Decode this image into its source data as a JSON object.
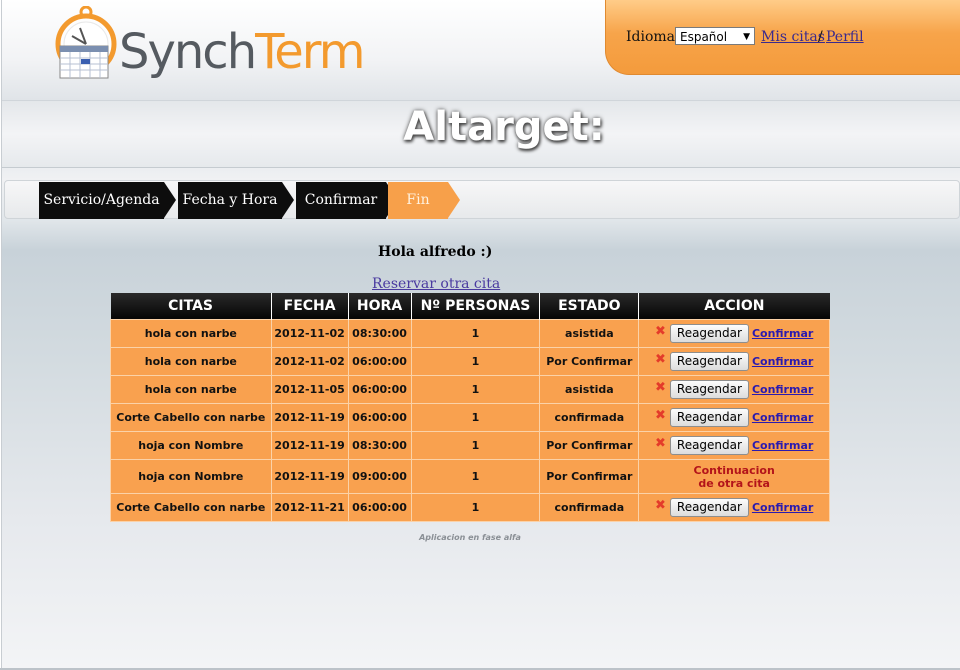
{
  "header": {
    "logo_text_1": "Synch",
    "logo_text_2": "Term",
    "language_label": "Idioma:",
    "language_selected": "Español",
    "mis_citas": "Mis citas",
    "separator": "/",
    "perfil": "Perfil"
  },
  "banner": {
    "title": "Altarget:"
  },
  "steps": [
    {
      "label": "Servicio/Agenda",
      "state": "done"
    },
    {
      "label": "Fecha y Hora",
      "state": "done"
    },
    {
      "label": "Confirmar",
      "state": "done"
    },
    {
      "label": "Fin",
      "state": "current"
    }
  ],
  "main": {
    "greeting": "Hola alfredo :)",
    "reservar_link": "Reservar otra cita"
  },
  "table": {
    "columns": [
      "CITAS",
      "FECHA",
      "HORA",
      "Nº PERSONAS",
      "ESTADO",
      "ACCION"
    ],
    "rows": [
      {
        "cita": "hola con narbe",
        "fecha": "2012-11-02",
        "hora": "08:30:00",
        "personas": "1",
        "estado": "asistida",
        "action": "buttons"
      },
      {
        "cita": "hola con narbe",
        "fecha": "2012-11-02",
        "hora": "06:00:00",
        "personas": "1",
        "estado": "Por Confirmar",
        "action": "buttons"
      },
      {
        "cita": "hola con narbe",
        "fecha": "2012-11-05",
        "hora": "06:00:00",
        "personas": "1",
        "estado": "asistida",
        "action": "buttons"
      },
      {
        "cita": "Corte Cabello con narbe",
        "fecha": "2012-11-19",
        "hora": "06:00:00",
        "personas": "1",
        "estado": "confirmada",
        "action": "buttons"
      },
      {
        "cita": "hoja con Nombre",
        "fecha": "2012-11-19",
        "hora": "08:30:00",
        "personas": "1",
        "estado": "Por Confirmar",
        "action": "buttons"
      },
      {
        "cita": "hoja con Nombre",
        "fecha": "2012-11-19",
        "hora": "09:00:00",
        "personas": "1",
        "estado": "Por Confirmar",
        "action": "text"
      },
      {
        "cita": "Corte Cabello con narbe",
        "fecha": "2012-11-21",
        "hora": "06:00:00",
        "personas": "1",
        "estado": "confirmada",
        "action": "buttons"
      }
    ],
    "reagendar_label": "Reagendar",
    "confirmar_label": "Confirmar",
    "continuacion_line1": "Continuacion",
    "continuacion_line2": "de otra cita",
    "delete_icon": "close-x-icon"
  },
  "footer": {
    "note": "Aplicacion en fase alfa"
  },
  "colors": {
    "brand_orange": "#f7a04a",
    "row_orange": "#f9a14f",
    "header_black": "#0d0d0d",
    "link_purple": "#3b2a8e",
    "continuacion_red": "#b3141a"
  }
}
